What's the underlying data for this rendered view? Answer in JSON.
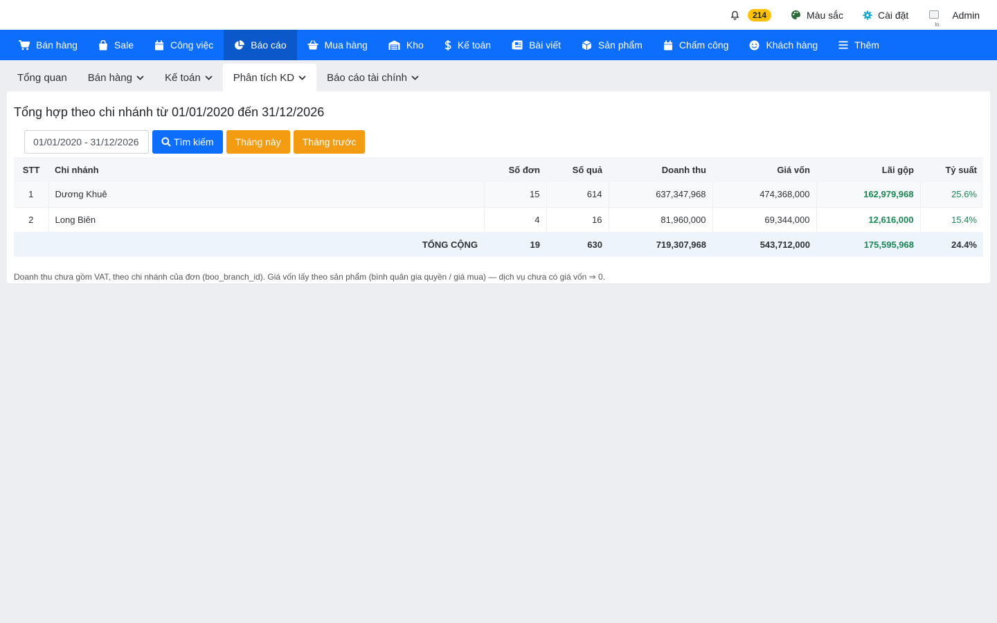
{
  "topbar": {
    "notification_count": "214",
    "colors_label": "Màu sắc",
    "settings_label": "Cài đặt",
    "user_label": "Admin",
    "avatar_alt": "lo"
  },
  "nav": {
    "items": [
      {
        "label": "Bán hàng",
        "icon": "cart-icon"
      },
      {
        "label": "Sale",
        "icon": "shopping-bag-icon"
      },
      {
        "label": "Công việc",
        "icon": "calendar-icon"
      },
      {
        "label": "Báo cáo",
        "icon": "pie-chart-icon"
      },
      {
        "label": "Mua hàng",
        "icon": "basket-icon"
      },
      {
        "label": "Kho",
        "icon": "warehouse-icon"
      },
      {
        "label": "Kế toán",
        "icon": "dollar-icon"
      },
      {
        "label": "Bài viết",
        "icon": "newspaper-icon"
      },
      {
        "label": "Sản phẩm",
        "icon": "box-icon"
      },
      {
        "label": "Chấm công",
        "icon": "calendar-icon"
      },
      {
        "label": "Khách hàng",
        "icon": "smile-icon"
      },
      {
        "label": "Thêm",
        "icon": "menu-icon"
      }
    ]
  },
  "subtabs": [
    {
      "label": "Tổng quan"
    },
    {
      "label": "Bán hàng"
    },
    {
      "label": "Kế toán"
    },
    {
      "label": "Phân tích KD"
    },
    {
      "label": "Báo cáo tài chính"
    }
  ],
  "report": {
    "title": "Tổng hợp theo chi nhánh từ 01/01/2020 đến 31/12/2026",
    "date_range": "01/01/2020 - 31/12/2026",
    "search_label": "Tìm kiếm",
    "this_month_label": "Tháng này",
    "last_month_label": "Tháng trước",
    "footnote": "Doanh thu chưa gồm VAT, theo chi nhánh của đơn (boo_branch_id). Giá vốn lấy theo sản phẩm (bình quân gia quyền / giá mua) — dịch vụ chưa có giá vốn ⇒ 0."
  },
  "table": {
    "headers": {
      "stt": "STT",
      "branch": "Chi nhánh",
      "orders": "Số đơn",
      "gifts": "Số quả",
      "revenue": "Doanh thu",
      "cost": "Giá vốn",
      "profit": "Lãi gộp",
      "margin": "Tỷ suất"
    },
    "rows": [
      {
        "stt": "1",
        "branch": "Dương Khuê",
        "orders": "15",
        "gifts": "614",
        "revenue": "637,347,968",
        "cost": "474,368,000",
        "profit": "162,979,968",
        "margin": "25.6%"
      },
      {
        "stt": "2",
        "branch": "Long Biên",
        "orders": "4",
        "gifts": "16",
        "revenue": "81,960,000",
        "cost": "69,344,000",
        "profit": "12,616,000",
        "margin": "15.4%"
      }
    ],
    "total": {
      "label": "TỔNG CỘNG",
      "orders": "19",
      "gifts": "630",
      "revenue": "719,307,968",
      "cost": "543,712,000",
      "profit": "175,595,968",
      "margin": "24.4%"
    }
  }
}
